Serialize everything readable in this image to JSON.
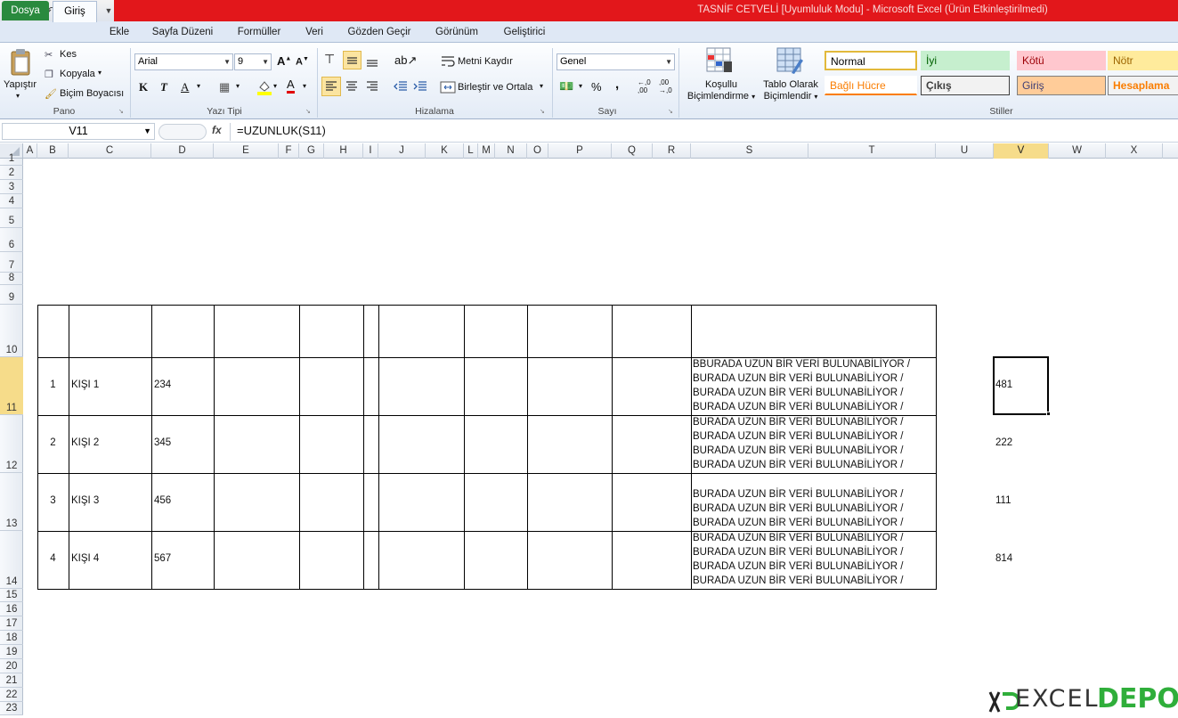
{
  "window": {
    "title": "TASNİF CETVELİ  [Uyumluluk Modu]  -  Microsoft Excel (Ürün Etkinleştirilmedi)"
  },
  "quick_access": {
    "app_icon": "X"
  },
  "tabs": [
    "Dosya",
    "Giriş",
    "Ekle",
    "Sayfa Düzeni",
    "Formüller",
    "Veri",
    "Gözden Geçir",
    "Görünüm",
    "Geliştirici"
  ],
  "ribbon": {
    "clipboard": {
      "paste": "Yapıştır",
      "cut": "Kes",
      "copy": "Kopyala",
      "format_painter": "Biçim Boyacısı",
      "label": "Pano"
    },
    "font": {
      "name": "Arial",
      "size": "9",
      "bold": "K",
      "italic": "T",
      "underline": "A",
      "color_letter": "A",
      "label": "Yazı Tipi"
    },
    "alignment": {
      "wrap_text": "Metni Kaydır",
      "merge": "Birleştir ve Ortala",
      "label": "Hizalama"
    },
    "number": {
      "format": "Genel",
      "percent": "%",
      "comma": ",",
      "label": "Sayı"
    },
    "styles": {
      "conditional": [
        "Koşullu",
        "Biçimlendirme"
      ],
      "as_table": [
        "Tablo Olarak",
        "Biçimlendir"
      ],
      "label": "Stiller",
      "cells": [
        {
          "name": "Normal",
          "bg": "#ffffff",
          "fg": "#000000",
          "border": "#e2b93b"
        },
        {
          "name": "İyi",
          "bg": "#c6efce",
          "fg": "#006100",
          "border": "#c6efce"
        },
        {
          "name": "Kötü",
          "bg": "#ffc7ce",
          "fg": "#9c0006",
          "border": "#ffc7ce"
        },
        {
          "name": "Nötr",
          "bg": "#ffeb9c",
          "fg": "#9c6500",
          "border": "#ffeb9c"
        },
        {
          "name": "Bağlı Hücre",
          "bg": "#ffffff",
          "fg": "#fa7d00",
          "border": "#ffffff"
        },
        {
          "name": "Çıkış",
          "bg": "#f2f2f2",
          "fg": "#3f3f3f",
          "border": "#3f3f3f"
        },
        {
          "name": "Giriş",
          "bg": "#ffcc99",
          "fg": "#3f3f76",
          "border": "#7f7f7f"
        },
        {
          "name": "Hesaplama",
          "bg": "#f2f2f2",
          "fg": "#fa7d00",
          "border": "#7f7f7f"
        }
      ]
    }
  },
  "formula_bar": {
    "name_box": "V11",
    "fx": "fx",
    "formula": "=UZUNLUK(S11)"
  },
  "columns": [
    "A",
    "B",
    "C",
    "D",
    "E",
    "F",
    "G",
    "H",
    "I",
    "J",
    "K",
    "L",
    "M",
    "N",
    "O",
    "P",
    "Q",
    "R",
    "S",
    "T",
    "U",
    "V",
    "W",
    "X"
  ],
  "rows": [
    "1",
    "2",
    "3",
    "4",
    "5",
    "6",
    "7",
    "8",
    "9",
    "10",
    "11",
    "12",
    "13",
    "14",
    "15",
    "16",
    "17",
    "18",
    "19",
    "20",
    "21",
    "22",
    "23"
  ],
  "selected": {
    "column": "V",
    "row": "11"
  },
  "table": {
    "rows": [
      {
        "no": "1",
        "name": "KİŞİ 1",
        "value": "234",
        "text": [
          "BBURADA UZUN BİR VERİ BULUNABİLİYOR /",
          "BURADA UZUN BİR VERİ BULUNABİLİYOR /",
          "BURADA UZUN BİR VERİ BULUNABİLİYOR /",
          "BURADA UZUN BİR VERİ BULUNABİLİYOR /"
        ],
        "length": "481"
      },
      {
        "no": "2",
        "name": "KİŞİ 2",
        "value": "345",
        "text": [
          "BURADA UZUN BİR VERİ BULUNABİLİYOR /",
          "BURADA UZUN BİR VERİ BULUNABİLİYOR /",
          "BURADA UZUN BİR VERİ BULUNABİLİYOR /",
          "BURADA UZUN BİR VERİ BULUNABİLİYOR /"
        ],
        "length": "222"
      },
      {
        "no": "3",
        "name": "KİŞİ 3",
        "value": "456",
        "text": [
          "BURADA UZUN BİR VERİ BULUNABİLİYOR /",
          "BURADA UZUN BİR VERİ BULUNABİLİYOR /",
          "BURADA UZUN BİR VERİ BULUNABİLİYOR /"
        ],
        "length": "111"
      },
      {
        "no": "4",
        "name": "KİŞİ 4",
        "value": "567",
        "text": [
          "BURADA UZUN BİR VERİ BULUNABİLİYOR /",
          "BURADA UZUN BİR VERİ BULUNABİLİYOR /",
          "BURADA UZUN BİR VERİ BULUNABİLİYOR /",
          "BURADA UZUN BİR VERİ BULUNABİLİYOR /"
        ],
        "length": "814"
      }
    ]
  },
  "watermark": {
    "text": "EXCEL",
    "accent_text": "DEPO"
  }
}
